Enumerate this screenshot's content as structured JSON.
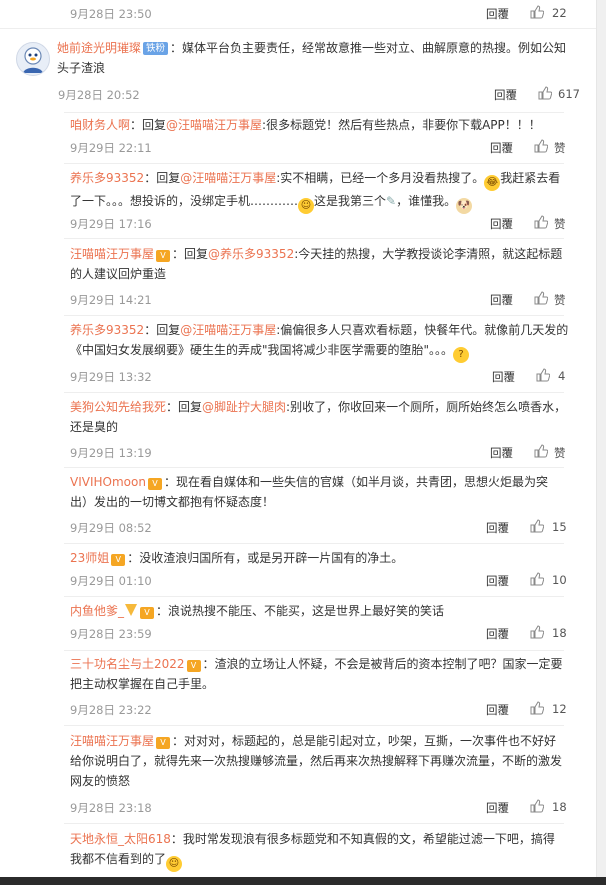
{
  "labels": {
    "reply": "回覆"
  },
  "top": {
    "time": "9月28日 23:50",
    "likes": "22"
  },
  "main": {
    "user": "她前途光明璀璨",
    "badge": "铁粉",
    "text_line1": "：媒体平台负主要责任，经常故意推一些对立、曲解原意的热搜。例如公知",
    "text_line2": "头子渣浪",
    "time": "9月28日 20:52",
    "likes": "617"
  },
  "replies": [
    {
      "user": "咱财务人啊",
      "pre": "：回复",
      "to": "@汪喵喵汪万事屋",
      "text": ":很多标题党！然后有些热点，非要你下载APP！！！",
      "time": "9月29日 22:11",
      "likes": "赞"
    },
    {
      "user": "养乐多93352",
      "pre": "：回复",
      "to": "@汪喵喵汪万事屋",
      "text": ":实不相瞒，已经一个多月没看热搜了。",
      "text_2": "我赶紧去看",
      "line2a": "了一下。。。想投诉的，没绑定手机…………",
      "line2b": "这是我第三个",
      "line2c": "，谁懂我。",
      "time": "9月29日 17:16",
      "likes": "赞"
    },
    {
      "user": "汪喵喵汪万事屋",
      "pre": "：回复",
      "to": "@养乐多93352",
      "text": ":今天挂的热搜，大学教授谈论李清照，就这起标题",
      "line2": "的人建议回炉重造",
      "time": "9月29日 14:21",
      "likes": "赞"
    },
    {
      "user": "养乐多93352",
      "pre": "：回复",
      "to": "@汪喵喵汪万事屋",
      "text": ":偏偏很多人只喜欢看标题，快餐年代。就像前几天发的",
      "line2": "《中国妇女发展纲要》硬生生的弄成\"我国将减少非医学需要的堕胎\"。。。",
      "time": "9月29日 13:32",
      "likes": "4"
    },
    {
      "user": "美狗公知先给我死",
      "pre": "：回复",
      "to": "@脚趾拧大腿肉",
      "text": ":别收了，你收回来一个厕所，厕所始终怎么喷香水，",
      "line2": "还是臭的",
      "time": "9月29日 13:19",
      "likes": "赞"
    },
    {
      "user": "VIVIHOmoon",
      "text": "：现在看自媒体和一些失信的官媒（如半月谈，共青团，思想火炬最为突",
      "line2": "出）发出的一切博文都抱有怀疑态度！",
      "time": "9月29日 08:52",
      "likes": "15"
    },
    {
      "user": "23师姐",
      "text": "：没收渣浪归国所有，或是另开辟一片国有的净土。",
      "time": "9月29日 01:10",
      "likes": "10"
    },
    {
      "user": "内鱼他爹_",
      "text": "：浪说热搜不能压、不能买，这是世界上最好笑的笑话",
      "time": "9月28日 23:59",
      "likes": "18"
    },
    {
      "user": "三十功名尘与土2022",
      "text": "：渣浪的立场让人怀疑，不会是被背后的资本控制了吧？国家一定要",
      "line2": "把主动权掌握在自己手里。",
      "time": "9月28日 23:22",
      "likes": "12"
    },
    {
      "user": "汪喵喵汪万事屋",
      "text": "：对对对，标题起的，总是能引起对立，吵架，互撕，一次事件也不好好",
      "line2": "给你说明白了，就得先来一次热搜赚够流量，然后再来次热搜解释下再赚次流量，不断的激发",
      "line3": "网友的愤怒",
      "time": "9月28日 23:18",
      "likes": "18"
    },
    {
      "user": "天地永恒_太阳618",
      "text": "：我时常发现浪有很多标题党和不知真假的文，希望能过滤一下吧，搞得",
      "line2": "我都不信看到的了",
      "time": "",
      "likes": ""
    }
  ]
}
